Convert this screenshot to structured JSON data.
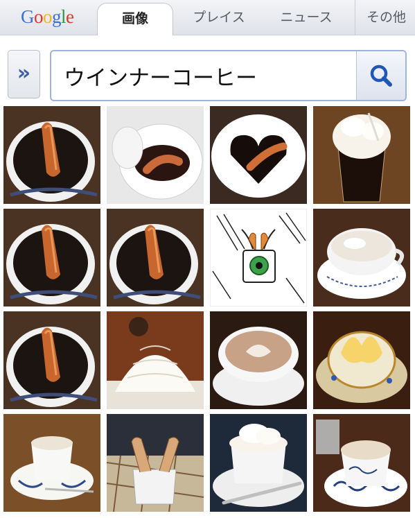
{
  "header": {
    "logo_text": "Google",
    "logo_colors": [
      "#3b6fd6",
      "#d83a2e",
      "#f0b51c",
      "#3b6fd6",
      "#2e9a45",
      "#d83a2e"
    ],
    "tabs": [
      {
        "label": "画像",
        "active": true
      },
      {
        "label": "プレイス",
        "active": false
      },
      {
        "label": "ニュース",
        "active": false
      },
      {
        "label": "その他",
        "active": false
      }
    ]
  },
  "search": {
    "expand_icon": "»",
    "query": "ウインナーコーヒー"
  },
  "results": {
    "thumbnails": [
      "sausage-in-coffee",
      "sausage-in-white-cup",
      "heart-coffee-with-sausage",
      "whipped-cream-float-glass",
      "sausage-in-coffee",
      "sausage-in-coffee",
      "sketch-cup-with-eye",
      "cream-coffee-blue-floral-cup",
      "sausage-in-coffee",
      "soft-serve-ice-cream",
      "latte-art-cup",
      "cream-in-gold-cup",
      "cream-cup-blue-saucer",
      "hands-in-cup",
      "whipped-cream-cup-spoon",
      "latte-blue-floral-cup"
    ]
  }
}
